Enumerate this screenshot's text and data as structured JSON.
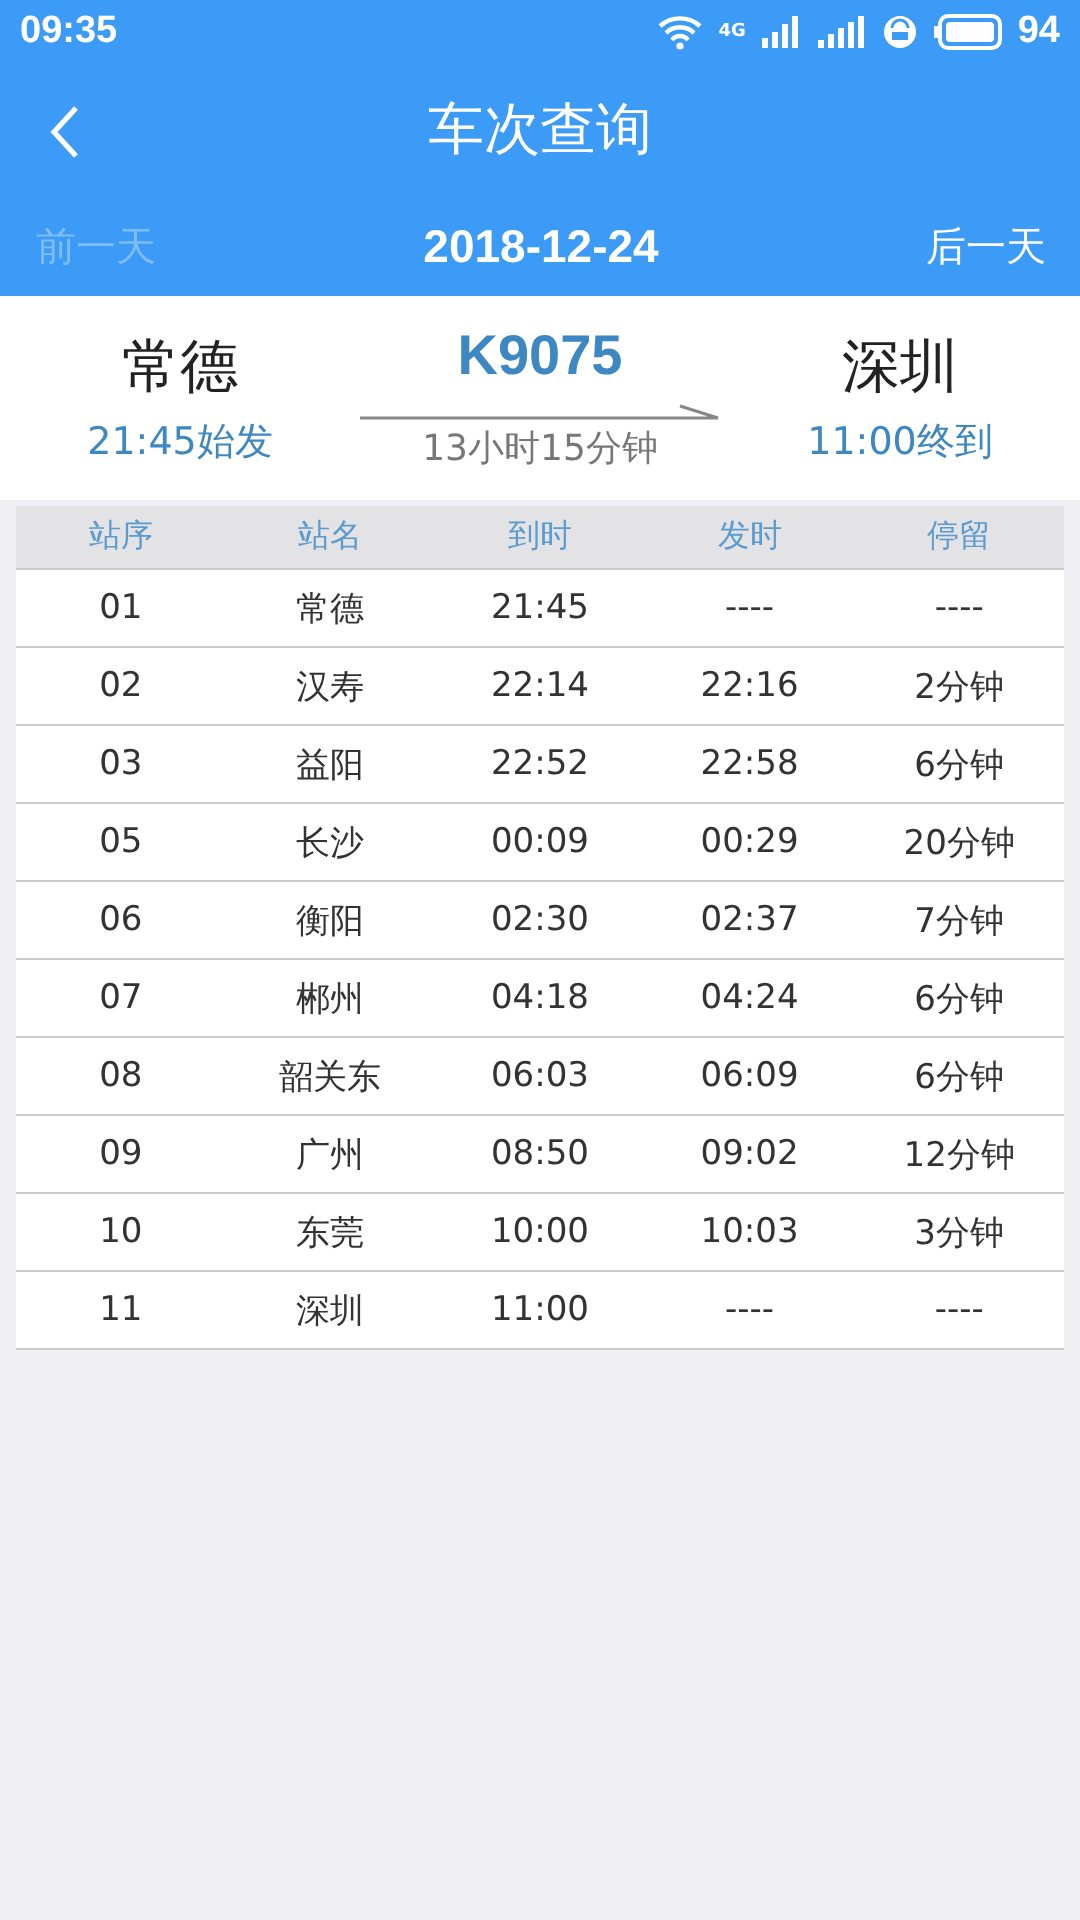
{
  "status_bar": {
    "time": "09:35",
    "network": "4G",
    "battery": "94"
  },
  "header": {
    "title": "车次查询",
    "prev_day": {
      "label": "前一天",
      "disabled": true
    },
    "date": "2018-12-24",
    "next_day": {
      "label": "后一天",
      "disabled": false
    }
  },
  "train": {
    "from": "常德",
    "depart": "21:45始发",
    "number": "K9075",
    "duration": "13小时15分钟",
    "to": "深圳",
    "arrive": "11:00终到"
  },
  "table": {
    "columns": [
      "站序",
      "站名",
      "到时",
      "发时",
      "停留"
    ],
    "rows": [
      [
        "01",
        "常德",
        "21:45",
        "----",
        "----"
      ],
      [
        "02",
        "汉寿",
        "22:14",
        "22:16",
        "2分钟"
      ],
      [
        "03",
        "益阳",
        "22:52",
        "22:58",
        "6分钟"
      ],
      [
        "05",
        "长沙",
        "00:09",
        "00:29",
        "20分钟"
      ],
      [
        "06",
        "衡阳",
        "02:30",
        "02:37",
        "7分钟"
      ],
      [
        "07",
        "郴州",
        "04:18",
        "04:24",
        "6分钟"
      ],
      [
        "08",
        "韶关东",
        "06:03",
        "06:09",
        "6分钟"
      ],
      [
        "09",
        "广州",
        "08:50",
        "09:02",
        "12分钟"
      ],
      [
        "10",
        "东莞",
        "10:00",
        "10:03",
        "3分钟"
      ],
      [
        "11",
        "深圳",
        "11:00",
        "----",
        "----"
      ]
    ]
  }
}
